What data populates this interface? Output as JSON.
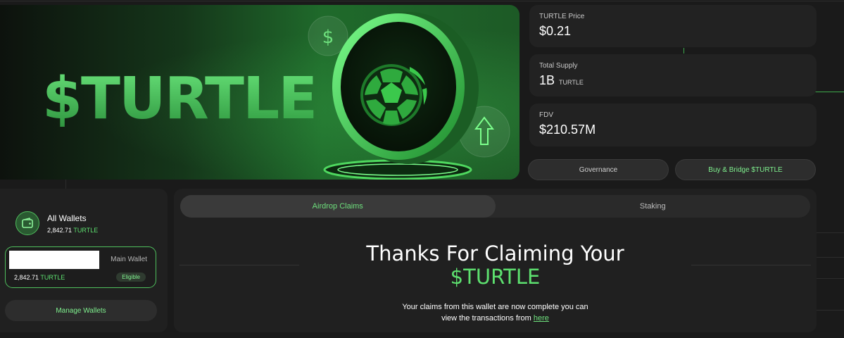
{
  "hero": {
    "title": "$TURTLE"
  },
  "stats": [
    {
      "label": "TURTLE Price",
      "value": "$0.21",
      "unit": ""
    },
    {
      "label": "Total Supply",
      "value": "1B",
      "unit": "TURTLE"
    },
    {
      "label": "FDV",
      "value": "$210.57M",
      "unit": ""
    }
  ],
  "actions": {
    "governance": "Governance",
    "buy_bridge": "Buy & Bridge $TURTLE"
  },
  "wallets": {
    "title": "All Wallets",
    "total_amount": "2,842.71",
    "token": "TURTLE",
    "main": {
      "label": "Main Wallet",
      "amount": "2,842.71",
      "token": "TURTLE",
      "status": "Eligible"
    },
    "manage_label": "Manage Wallets"
  },
  "claims": {
    "tabs": [
      {
        "label": "Airdrop Claims",
        "active": true
      },
      {
        "label": "Staking",
        "active": false
      }
    ],
    "heading": "Thanks For Claiming Your",
    "heading_token": "$TURTLE",
    "description": "Your claims from this wallet are now complete you can",
    "description_line2": "view the transactions from",
    "link_text": "here"
  },
  "colors": {
    "accent": "#5de06f",
    "background": "#1a1a1a",
    "card": "#222222"
  },
  "icons": [
    "dollar-icon",
    "arrow-up-icon",
    "turtle-shell-icon",
    "wallet-icon"
  ]
}
